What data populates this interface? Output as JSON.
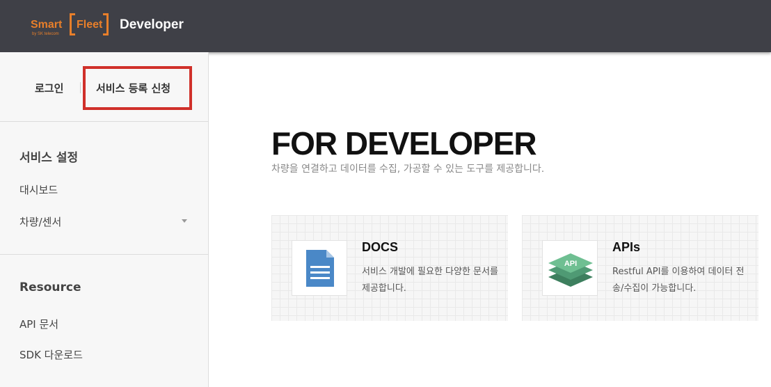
{
  "header": {
    "logo_smart": "Smart",
    "logo_subtext": "by SK telecom",
    "logo_fleet": "Fleet",
    "logo_developer": "Developer",
    "bg_color": "#3f4047",
    "brand_color": "#e87f2a"
  },
  "sidebar": {
    "login_label": "로그인",
    "register_label": "서비스 등록 신청",
    "sections": [
      {
        "title": "서비스 설정",
        "items": [
          "대시보드",
          "차량/센서"
        ]
      },
      {
        "title": "Resource",
        "items": [
          "API 문서",
          "SDK 다운로드"
        ]
      }
    ]
  },
  "main": {
    "title": "FOR DEVELOPER",
    "subtitle": "차량을 연결하고 데이터를 수집, 가공할 수 있는 도구를 제공합니다.",
    "cards": [
      {
        "title": "DOCS",
        "description": "서비스 개발에 필요한 다양한 문서를 제공합니다.",
        "icon": "document-icon",
        "icon_color": "#4a88c7"
      },
      {
        "title": "APIs",
        "description": "Restful API를 이용하여 데이터 전송/수집이 가능합니다.",
        "icon": "api-layers-icon",
        "icon_label": "API",
        "icon_color": "#5aa982"
      }
    ]
  },
  "highlight_color": "#d0302a"
}
